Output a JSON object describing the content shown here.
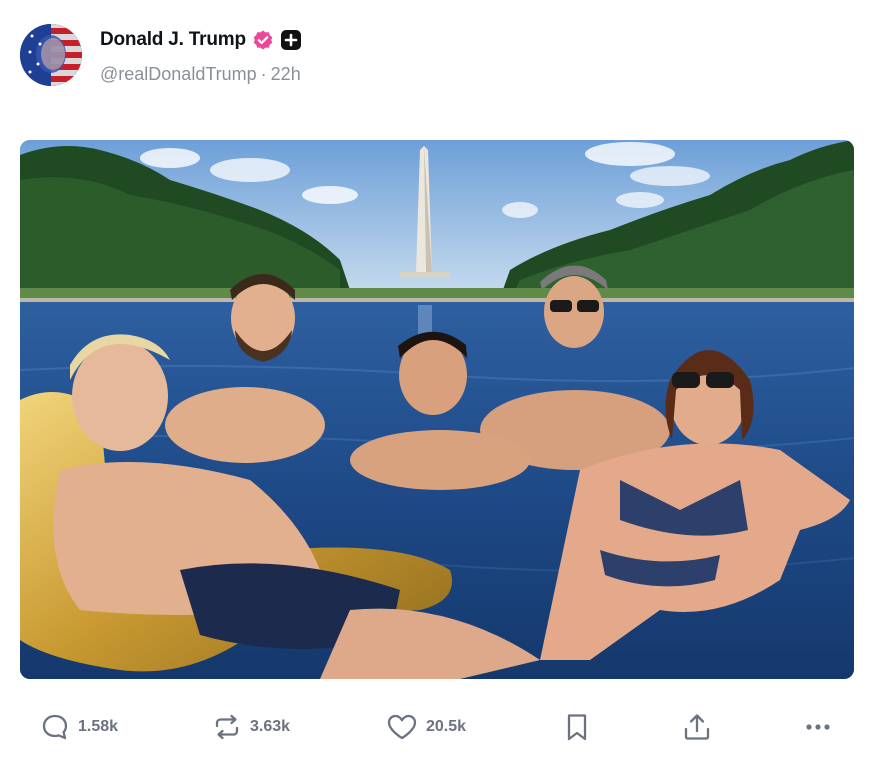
{
  "post": {
    "author": {
      "display_name": "Donald J. Trump",
      "handle": "@realDonaldTrump",
      "separator": "·",
      "time_ago": "22h",
      "verified_icon": "verified-badge-icon",
      "verified_color": "#ec4899",
      "extra_badge_icon": "plus-square-icon"
    },
    "media": {
      "type": "photo",
      "subject_icon": "photo-pool-scene"
    },
    "actions": {
      "reply": {
        "icon": "reply-bubble-icon",
        "count": "1.58k"
      },
      "repost": {
        "icon": "repost-icon",
        "count": "3.63k"
      },
      "like": {
        "icon": "heart-icon",
        "count": "20.5k"
      },
      "bookmark": {
        "icon": "bookmark-icon"
      },
      "share": {
        "icon": "share-upload-icon"
      },
      "more": {
        "icon": "more-dots-icon"
      }
    },
    "colors": {
      "action_gray": "#6b7280",
      "handle_gray": "#8a8f98",
      "text": "#0f1419"
    }
  }
}
